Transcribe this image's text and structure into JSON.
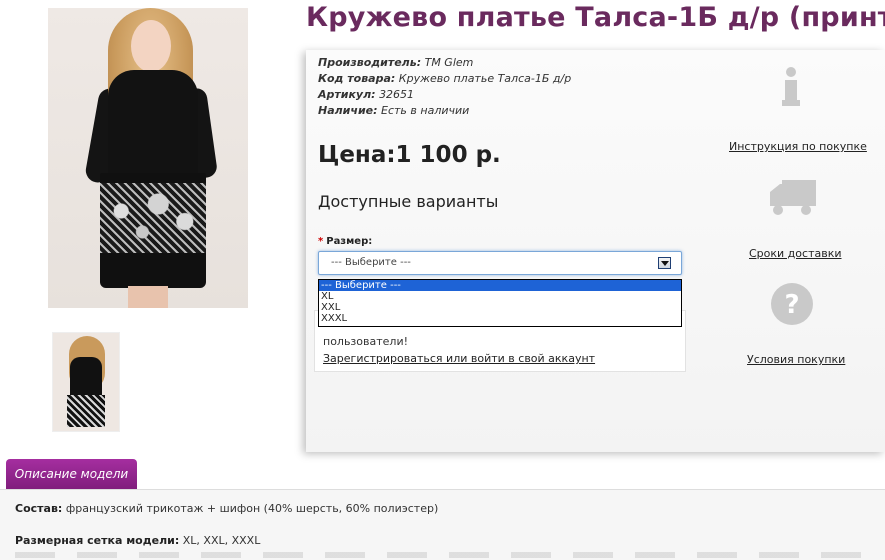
{
  "product": {
    "title": "Кружево платье Талса-1Б д/р (принт)",
    "manufacturer_label": "Производитель:",
    "manufacturer_value": "ТМ Glem",
    "code_label": "Код товара:",
    "code_value": "Кружево платье Талса-1Б д/р",
    "article_label": "Артикул:",
    "article_value": "32651",
    "availability_label": "Наличие:",
    "availability_value": "Есть в наличии",
    "price": "Цена:1 100 р."
  },
  "options": {
    "heading": "Доступные варианты",
    "size_label": "Размер:",
    "required_mark": "*",
    "select_value": "--- Выберите ---",
    "dropdown": [
      "--- Выберите ---",
      "XL",
      "XXL",
      "XXXL"
    ],
    "selected_index": 0
  },
  "login": {
    "text": "пользователи!",
    "link": "Зарегистрироваться или войти в свой аккаунт"
  },
  "side_links": {
    "instructions": "Инструкция по покупке",
    "delivery": "Сроки доставки",
    "conditions": "Условия покупки"
  },
  "tabs": {
    "description": "Описание модели"
  },
  "description": {
    "composition_label": "Состав:",
    "composition_value": "французский трикотаж + шифон (40% шерсть, 60% полиэстер)",
    "sizes_label": "Размерная сетка модели:",
    "sizes_value": "XL, XXL, XXXL"
  },
  "colors": {
    "title": "#6a2a5e",
    "tab": "#a52ea0",
    "dropdown_highlight": "#1e63d6"
  },
  "icons": [
    "info-icon",
    "truck-icon",
    "question-icon",
    "chevron-down-icon"
  ]
}
